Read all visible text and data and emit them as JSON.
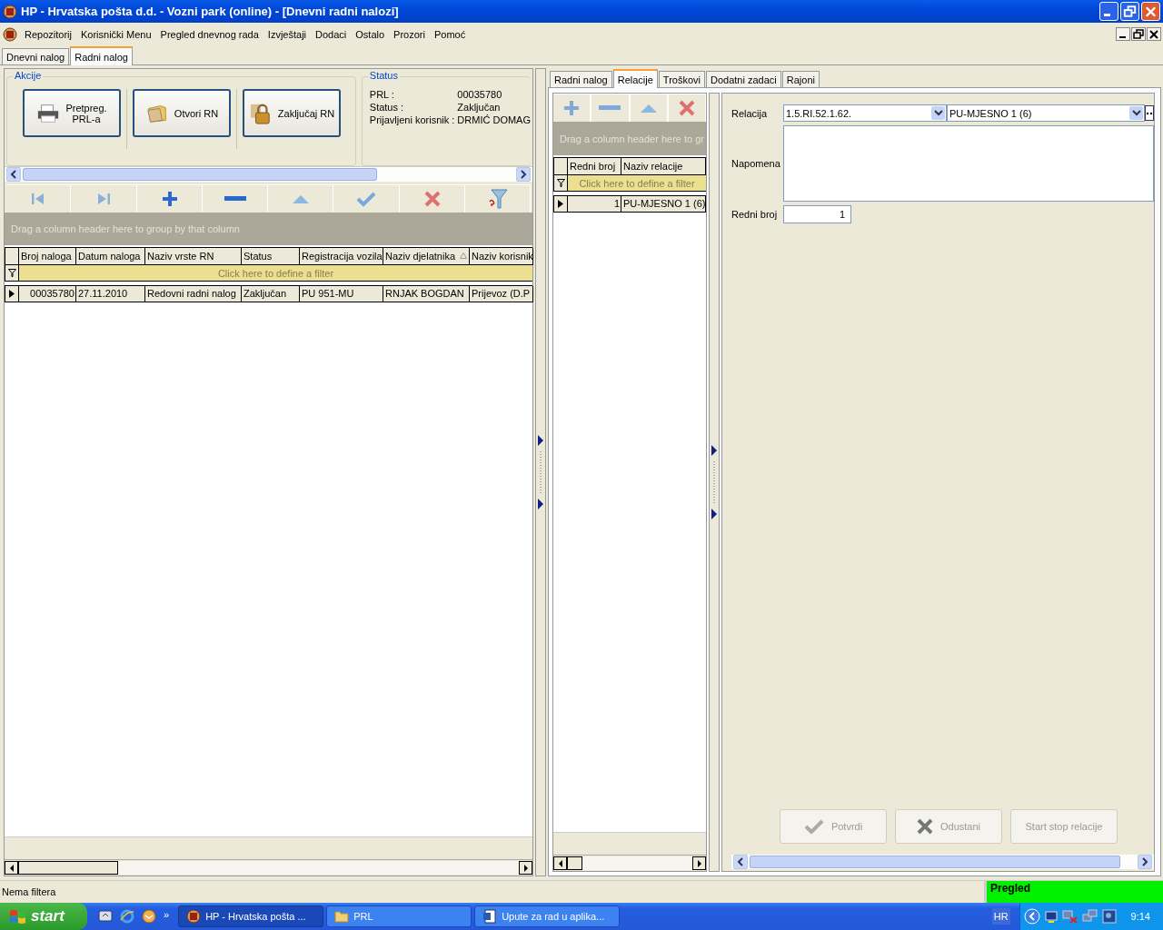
{
  "window": {
    "title": "HP - Hrvatska pošta d.d. - Vozni park (online) - [Dnevni radni nalozi]"
  },
  "menu": [
    "Repozitorij",
    "Korisnički Menu",
    "Pregled dnevnog rada",
    "Izvještaji",
    "Dodaci",
    "Ostalo",
    "Prozori",
    "Pomoć"
  ],
  "document_tabs": [
    {
      "label": "Dnevni nalog",
      "selected": false
    },
    {
      "label": "Radni nalog",
      "selected": true
    }
  ],
  "actions_group": {
    "title": "Akcije",
    "buttons": [
      {
        "label": "Pretpreg.\nPRL-a",
        "kind": "printer"
      },
      {
        "label": "Otvori RN",
        "kind": "folder"
      },
      {
        "label": "Zaključaj RN",
        "kind": "lock"
      }
    ]
  },
  "status_group": {
    "title": "Status",
    "fields": [
      {
        "label": "PRL :",
        "value": "00035780"
      },
      {
        "label": "Status :",
        "value": "Zaključan"
      },
      {
        "label": "Prijavljeni korisnik :",
        "value": "DRMIĆ DOMAG"
      }
    ]
  },
  "orders_grid": {
    "group_hint": "Drag a column header here to group by that column",
    "filter_hint": "Click here to define a filter",
    "columns": [
      {
        "label": "Broj naloga",
        "sorted": false
      },
      {
        "label": "Datum naloga",
        "sorted": false
      },
      {
        "label": "Naziv vrste RN",
        "sorted": false
      },
      {
        "label": "Status",
        "sorted": false
      },
      {
        "label": "Registracija vozila",
        "sorted": false
      },
      {
        "label": "Naziv djelatnika",
        "sorted": true
      },
      {
        "label": "Naziv korisnik",
        "sorted": false
      }
    ],
    "rows": [
      {
        "selected": true,
        "cells": [
          "00035780",
          "27.11.2010",
          "Redovni radni nalog",
          "Zaključan",
          "PU 951-MU",
          "RNJAK BOGDAN",
          "Prijevoz (D.P"
        ]
      }
    ]
  },
  "detail_tabs": [
    {
      "label": "Radni nalog",
      "selected": false
    },
    {
      "label": "Relacije",
      "selected": true
    },
    {
      "label": "Troškovi",
      "selected": false
    },
    {
      "label": "Dodatni zadaci",
      "selected": false
    },
    {
      "label": "Rajoni",
      "selected": false
    }
  ],
  "relations_grid": {
    "group_hint": "Drag a column header here to gr",
    "filter_hint": "Click here to define a filter",
    "columns": [
      {
        "label": "Redni broj"
      },
      {
        "label": "Naziv relacije"
      }
    ],
    "rows": [
      {
        "selected": true,
        "cells": [
          "1",
          "PU-MJESNO 1 (6)"
        ]
      }
    ]
  },
  "relation_form": {
    "relation_label": "Relacija",
    "relation_code": "1.5.RI.52.1.62.",
    "relation_name": "PU-MJESNO 1 (6)",
    "note_label": "Napomena",
    "order_label": "Redni broj",
    "order_value": "1",
    "buttons": [
      {
        "label": "Potvrdi",
        "kind": "check",
        "disabled": true
      },
      {
        "label": "Odustani",
        "kind": "cancel",
        "disabled": true
      },
      {
        "label": "Start stop relacije",
        "kind": "text",
        "disabled": true
      }
    ]
  },
  "status_bar": {
    "filter": "Nema filtera",
    "mode": "Pregled"
  },
  "taskbar": {
    "start": "start",
    "more": "»",
    "tasks": [
      {
        "label": "HP - Hrvatska pošta ...",
        "kind": "app",
        "selected": true
      },
      {
        "label": "PRL",
        "kind": "folder",
        "selected": false
      },
      {
        "label": "Upute za rad u aplika...",
        "kind": "word",
        "selected": false
      }
    ],
    "language": "HR",
    "clock": "9:14"
  }
}
